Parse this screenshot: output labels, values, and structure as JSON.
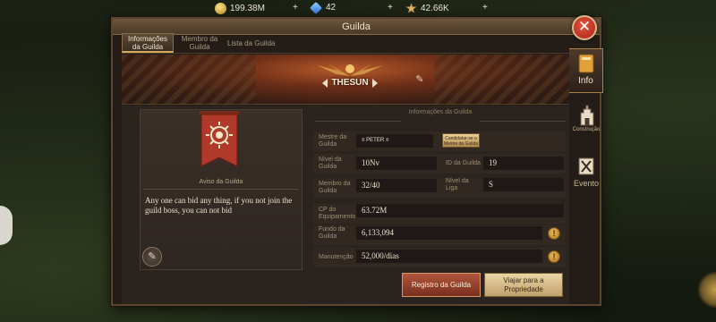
{
  "resources": {
    "gold": "199.38M",
    "gems": "42",
    "power": "42.66K"
  },
  "window": {
    "title": "Guilda"
  },
  "tabs": [
    {
      "label": "Informações da Guilda"
    },
    {
      "label": "Membro da Guilda"
    },
    {
      "label": "Lista da Guilda"
    }
  ],
  "guild": {
    "name": "THESUN"
  },
  "notice": {
    "label": "Aviso da Guilda",
    "text": "Any one can bid any thing, if you not join the guild boss, you can not bid"
  },
  "info": {
    "title": "Informações da Guilda",
    "master_label": "Mestre da Guilda",
    "master_value": "PETER",
    "candidate_button": "Candidatar-se a Mestre da Guilda",
    "level_label": "Nível da Guilda",
    "level_value": "10Nv",
    "id_label": "ID da Guilda",
    "id_value": "19",
    "members_label": "Membro da Guilda",
    "members_value": "32/40",
    "league_label": "Nível da Liga",
    "league_value": "S",
    "cp_label": "CP do Equipamento",
    "cp_value": "63.72M",
    "fund_label": "Fundo da Guilda",
    "fund_value": "6,133,094",
    "maint_label": "Manutenção",
    "maint_value": "52,000/dias"
  },
  "buttons": {
    "register": "Registro da Guilda",
    "travel": "Viajar para a Propriedade"
  },
  "sidenav": [
    {
      "label": "Info",
      "icon": "book-icon"
    },
    {
      "label": "Construção",
      "icon": "castle-icon"
    },
    {
      "label": "Evento",
      "icon": "crossed-swords-icon"
    }
  ],
  "colors": {
    "accent_gold": "#d4a95a",
    "banner_red": "#b0392a",
    "close_red": "#d63b27"
  }
}
